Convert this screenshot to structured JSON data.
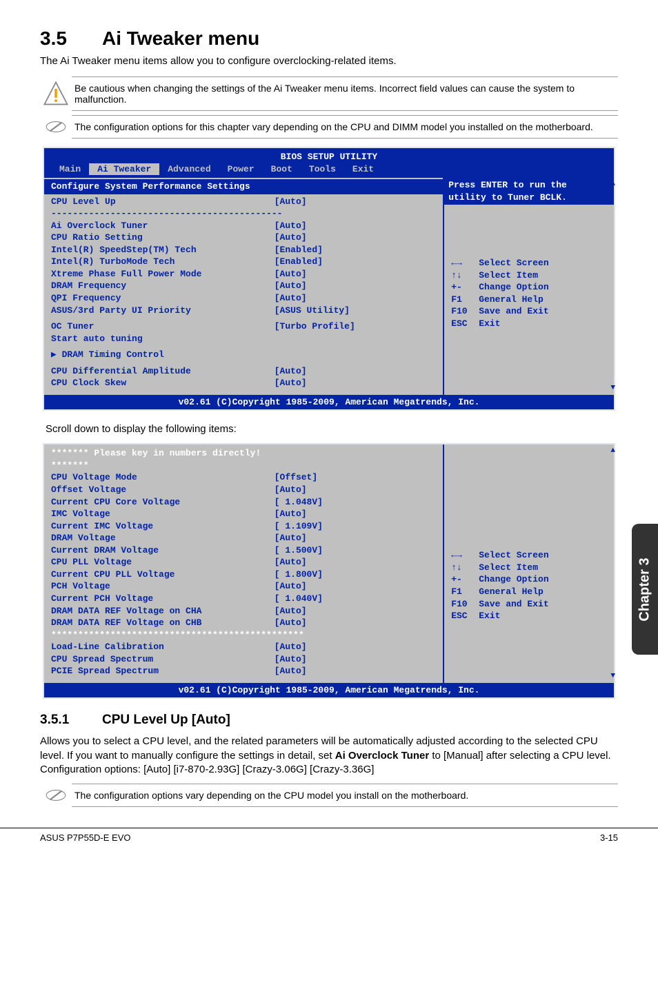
{
  "header": {
    "section_no": "3.5",
    "section_title": "Ai Tweaker menu",
    "intro": "The Ai Tweaker menu items allow you to configure overclocking-related items."
  },
  "notes": {
    "warn": "Be cautious when changing the settings of the Ai Tweaker menu items. Incorrect field values can cause the system to malfunction.",
    "info1": "The configuration options for this chapter vary depending on the CPU and DIMM model you installed on the motherboard."
  },
  "bios1": {
    "title": "BIOS SETUP UTILITY",
    "tabs": [
      "Main",
      "Ai Tweaker",
      "Advanced",
      "Power",
      "Boot",
      "Tools",
      "Exit"
    ],
    "selected_tab": "Ai Tweaker",
    "heading": "Configure System Performance Settings",
    "rows": [
      {
        "lbl": "CPU Level Up",
        "val": "[Auto]",
        "style": "yellow"
      },
      {
        "lbl": "-------------------------------------------",
        "val": "",
        "style": "sep"
      },
      {
        "lbl": "Ai Overclock Tuner",
        "val": "[Auto]",
        "style": ""
      },
      {
        "lbl": "CPU Ratio Setting",
        "val": "[Auto]",
        "style": ""
      },
      {
        "lbl": "Intel(R) SpeedStep(TM) Tech",
        "val": "[Enabled]",
        "style": ""
      },
      {
        "lbl": "Intel(R) TurboMode Tech",
        "val": "[Enabled]",
        "style": ""
      },
      {
        "lbl": "Xtreme Phase Full Power Mode",
        "val": "[Auto]",
        "style": ""
      },
      {
        "lbl": "DRAM Frequency",
        "val": "[Auto]",
        "style": ""
      },
      {
        "lbl": "QPI Frequency",
        "val": "[Auto]",
        "style": ""
      },
      {
        "lbl": "ASUS/3rd Party UI Priority",
        "val": "[ASUS Utility]",
        "style": ""
      },
      {
        "lbl": "",
        "val": "",
        "style": "gap"
      },
      {
        "lbl": "OC Tuner",
        "val": "[Turbo Profile]",
        "style": ""
      },
      {
        "lbl": "Start auto tuning",
        "val": "",
        "style": ""
      },
      {
        "lbl": "",
        "val": "",
        "style": "gap"
      },
      {
        "lbl": "▶ DRAM Timing Control",
        "val": "",
        "style": ""
      },
      {
        "lbl": "",
        "val": "",
        "style": "gap"
      },
      {
        "lbl": "CPU Differential Amplitude",
        "val": "[Auto]",
        "style": ""
      },
      {
        "lbl": "CPU Clock Skew",
        "val": "[Auto]",
        "style": ""
      }
    ],
    "help_top1": "Press ENTER to run the",
    "help_top2": "utility to Tuner BCLK.",
    "help_keys": [
      {
        "k": "←→",
        "t": "Select Screen"
      },
      {
        "k": "↑↓",
        "t": "Select Item"
      },
      {
        "k": "+-",
        "t": "Change Option"
      },
      {
        "k": "F1",
        "t": "General Help"
      },
      {
        "k": "F10",
        "t": "Save and Exit"
      },
      {
        "k": "ESC",
        "t": "Exit"
      }
    ],
    "footer": "v02.61 (C)Copyright 1985-2009, American Megatrends, Inc."
  },
  "scroll_caption": "Scroll down to display the following items:",
  "bios2": {
    "rows": [
      {
        "lbl": "******* Please key in numbers directly! *******",
        "val": "",
        "style": "white"
      },
      {
        "lbl": "CPU Voltage Mode",
        "val": "[Offset]",
        "style": ""
      },
      {
        "lbl": "  Offset Voltage",
        "val": "[Auto]",
        "style": ""
      },
      {
        "lbl": "  Current CPU Core Voltage",
        "val": "[ 1.048V]",
        "style": ""
      },
      {
        "lbl": "IMC Voltage",
        "val": "[Auto]",
        "style": ""
      },
      {
        "lbl": "  Current IMC Voltage",
        "val": "[ 1.109V]",
        "style": ""
      },
      {
        "lbl": "DRAM Voltage",
        "val": "[Auto]",
        "style": ""
      },
      {
        "lbl": "  Current DRAM Voltage",
        "val": "[ 1.500V]",
        "style": ""
      },
      {
        "lbl": "CPU PLL Voltage",
        "val": "[Auto]",
        "style": ""
      },
      {
        "lbl": "  Current CPU PLL Voltage",
        "val": "[ 1.800V]",
        "style": ""
      },
      {
        "lbl": "PCH Voltage",
        "val": "[Auto]",
        "style": ""
      },
      {
        "lbl": "  Current PCH Voltage",
        "val": "[ 1.040V]",
        "style": ""
      },
      {
        "lbl": "DRAM DATA REF Voltage on CHA",
        "val": "[Auto]",
        "style": ""
      },
      {
        "lbl": "DRAM DATA REF Voltage on CHB",
        "val": "[Auto]",
        "style": ""
      },
      {
        "lbl": "***********************************************",
        "val": "",
        "style": "white"
      },
      {
        "lbl": "Load-Line Calibration",
        "val": "[Auto]",
        "style": ""
      },
      {
        "lbl": "CPU Spread Spectrum",
        "val": "[Auto]",
        "style": ""
      },
      {
        "lbl": "PCIE Spread Spectrum",
        "val": "[Auto]",
        "style": ""
      }
    ],
    "help_keys": [
      {
        "k": "←→",
        "t": "Select Screen"
      },
      {
        "k": "↑↓",
        "t": "Select Item"
      },
      {
        "k": "+-",
        "t": "Change Option"
      },
      {
        "k": "F1",
        "t": "General Help"
      },
      {
        "k": "F10",
        "t": "Save and Exit"
      },
      {
        "k": "ESC",
        "t": "Exit"
      }
    ],
    "footer": "v02.61 (C)Copyright 1985-2009, American Megatrends, Inc."
  },
  "sub": {
    "num": "3.5.1",
    "title": "CPU Level Up [Auto]",
    "para_before": "Allows you to select a CPU level, and the related parameters will be automatically adjusted according to the selected CPU level. If you want to manually configure the settings in detail, set ",
    "bold": "Ai Overclock Tuner",
    "para_after": " to [Manual] after selecting a CPU level. Configuration options: [Auto] [i7-870-2.93G] [Crazy-3.06G] [Crazy-3.36G]"
  },
  "note2": "The configuration options vary depending on the CPU model you install on the motherboard.",
  "chapter_tab": "Chapter 3",
  "footer": {
    "left": "ASUS P7P55D-E EVO",
    "right": "3-15"
  }
}
